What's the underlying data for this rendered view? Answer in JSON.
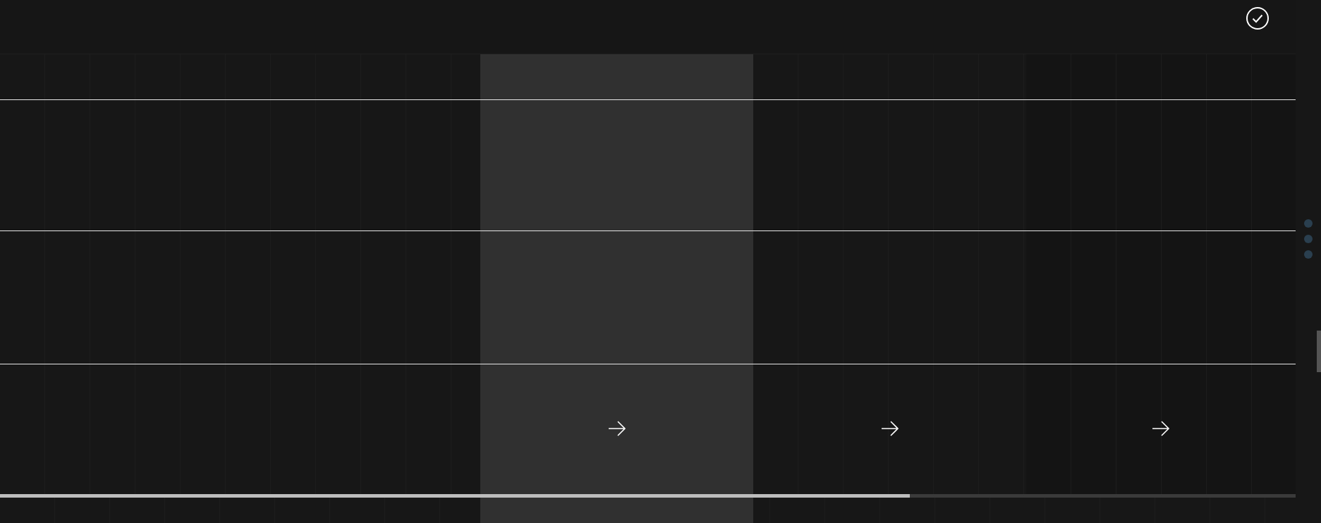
{
  "header": {
    "confirmed": true
  },
  "columns": [
    {
      "selected": false,
      "arrow": false
    },
    {
      "selected": true,
      "arrow": true
    },
    {
      "selected": false,
      "arrow": true
    },
    {
      "selected": false,
      "arrow": true
    }
  ],
  "progress": {
    "level": 0.702
  },
  "pager": [
    {
      "selected": false
    },
    {
      "selected": false
    },
    {
      "selected": false
    }
  ]
}
